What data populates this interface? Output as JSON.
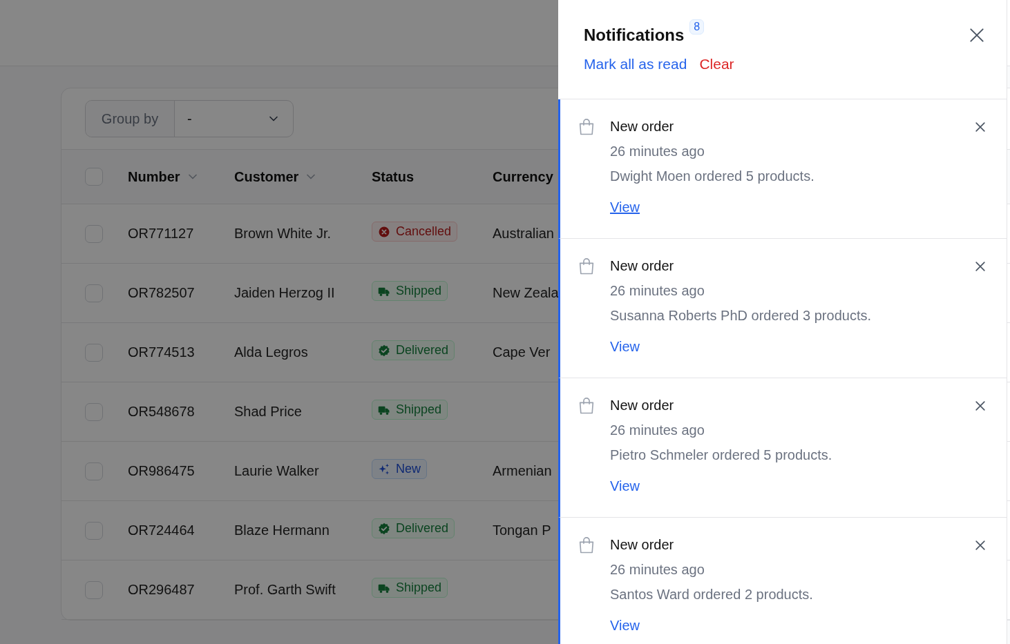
{
  "table": {
    "group_by": {
      "label": "Group by",
      "value": "-"
    },
    "columns": [
      {
        "label": "Number",
        "sortable": true
      },
      {
        "label": "Customer",
        "sortable": true
      },
      {
        "label": "Status",
        "sortable": false
      },
      {
        "label": "Currency",
        "sortable": false
      }
    ],
    "rows": [
      {
        "checked": false,
        "number": "OR771127",
        "customer": "Brown White Jr.",
        "status": {
          "kind": "cancelled",
          "label": "Cancelled"
        },
        "currency": "Australian"
      },
      {
        "checked": false,
        "number": "OR782507",
        "customer": "Jaiden Herzog II",
        "status": {
          "kind": "shipped",
          "label": "Shipped"
        },
        "currency": "New Zeala"
      },
      {
        "checked": false,
        "number": "OR774513",
        "customer": "Alda Legros",
        "status": {
          "kind": "delivered",
          "label": "Delivered"
        },
        "currency": "Cape Ver"
      },
      {
        "checked": false,
        "number": "OR548678",
        "customer": "Shad Price",
        "status": {
          "kind": "shipped",
          "label": "Shipped"
        }
      },
      {
        "checked": false,
        "number": "OR986475",
        "customer": "Laurie Walker",
        "status": {
          "kind": "new",
          "label": "New"
        },
        "currency": "Armenian"
      },
      {
        "checked": false,
        "number": "OR724464",
        "customer": "Blaze Hermann",
        "status": {
          "kind": "delivered",
          "label": "Delivered"
        },
        "currency": "Tongan P"
      },
      {
        "checked": false,
        "number": "OR296487",
        "customer": "Prof. Garth Swift",
        "status": {
          "kind": "shipped",
          "label": "Shipped"
        }
      }
    ],
    "all_checked": false
  },
  "notifications": {
    "title": "Notifications",
    "count": "8",
    "mark_all": "Mark all as read",
    "clear": "Clear",
    "items": [
      {
        "unread": true,
        "title": "New order",
        "time": "26 minutes ago",
        "body": "Dwight Moen ordered 5 products.",
        "action": "View",
        "hovered": true
      },
      {
        "unread": true,
        "title": "New order",
        "time": "26 minutes ago",
        "body": "Susanna Roberts PhD ordered 3 products.",
        "action": "View",
        "hovered": false
      },
      {
        "unread": true,
        "title": "New order",
        "time": "26 minutes ago",
        "body": "Pietro Schmeler ordered 5 products.",
        "action": "View",
        "hovered": false
      },
      {
        "unread": true,
        "title": "New order",
        "time": "26 minutes ago",
        "body": "Santos Ward ordered 2 products.",
        "action": "View",
        "hovered": false
      }
    ]
  }
}
